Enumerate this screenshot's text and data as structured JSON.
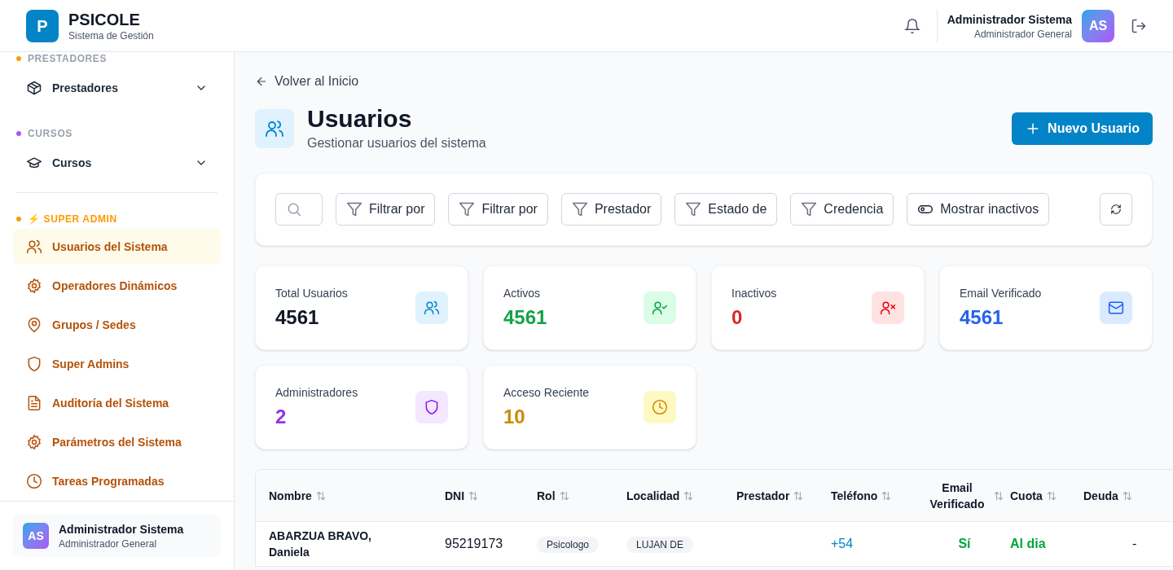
{
  "header": {
    "logo_letter": "P",
    "app_name": "PSICOLE",
    "app_subtitle": "Sistema de Gestión",
    "user_name": "Administrador Sistema",
    "user_role": "Administrador General",
    "avatar": "AS"
  },
  "sidebar": {
    "sections": [
      {
        "label": "PRESTADORES",
        "kind": "group",
        "color": "#f59e0b",
        "items": [
          {
            "label": "Prestadores",
            "kind": "box",
            "expandable": true,
            "selected": false
          }
        ]
      },
      {
        "label": "CURSOS",
        "kind": "group",
        "color": "#a855f7",
        "items": [
          {
            "label": "Cursos",
            "kind": "cap",
            "expandable": true,
            "selected": false
          }
        ]
      },
      {
        "label": "⚡ SUPER ADMIN",
        "kind": "admin",
        "color": "#f59e0b",
        "items": [
          {
            "label": "Usuarios del Sistema",
            "kind": "users",
            "expandable": false,
            "selected": true
          },
          {
            "label": "Operadores Dinámicos",
            "kind": "gear",
            "expandable": false,
            "selected": false
          },
          {
            "label": "Grupos / Sedes",
            "kind": "pin",
            "expandable": false,
            "selected": false
          },
          {
            "label": "Super Admins",
            "kind": "shield",
            "expandable": false,
            "selected": false
          },
          {
            "label": "Auditoría del Sistema",
            "kind": "doc",
            "expandable": false,
            "selected": false
          },
          {
            "label": "Parámetros del Sistema",
            "kind": "gear",
            "expandable": false,
            "selected": false
          },
          {
            "label": "Tareas Programadas",
            "kind": "clock",
            "expandable": false,
            "selected": false
          }
        ]
      }
    ],
    "footer": {
      "avatar": "AS",
      "name": "Administrador Sistema",
      "role": "Administrador General"
    }
  },
  "back_link": "Volver al Inicio",
  "page": {
    "title": "Usuarios",
    "subtitle": "Gestionar usuarios del sistema",
    "new_button": "Nuevo Usuario"
  },
  "filters": [
    {
      "kind": "search"
    },
    {
      "kind": "filter",
      "label": "Filtrar por"
    },
    {
      "kind": "filter",
      "label": "Filtrar por"
    },
    {
      "kind": "filter",
      "label": "Prestador"
    },
    {
      "kind": "filter",
      "label": "Estado de"
    },
    {
      "kind": "filter",
      "label": "Credencia"
    },
    {
      "kind": "toggle",
      "label": "Mostrar inactivos",
      "on": false
    },
    {
      "kind": "refresh"
    }
  ],
  "stats": [
    {
      "label": "Total Usuarios",
      "value": "4561",
      "kind": "users",
      "color": "#111827"
    },
    {
      "label": "Activos",
      "value": "4561",
      "kind": "user-check",
      "color": "#16a34a"
    },
    {
      "label": "Inactivos",
      "value": "0",
      "kind": "user-x",
      "color": "#dc2626"
    },
    {
      "label": "Email Verificado",
      "value": "4561",
      "kind": "mail",
      "color": "#2563eb"
    },
    {
      "label": "Administradores",
      "value": "2",
      "kind": "shield",
      "color": "#9333ea"
    },
    {
      "label": "Acceso Reciente",
      "value": "10",
      "kind": "clock",
      "color": "#ca8a04"
    }
  ],
  "table": {
    "columns": [
      "Nombre",
      "DNI",
      "Rol",
      "Localidad",
      "Prestador",
      "Teléfono",
      "Email Verificado",
      "Cuota",
      "Deuda"
    ],
    "rows": [
      {
        "nombre": "ABARZUA BRAVO, Daniela",
        "dni": "95219173",
        "rol": "Psicologo",
        "localidad": "LUJAN DE",
        "telefono": "+54",
        "email_verificado": "Sí",
        "cuota": "Al dia",
        "deuda": "-"
      }
    ]
  }
}
